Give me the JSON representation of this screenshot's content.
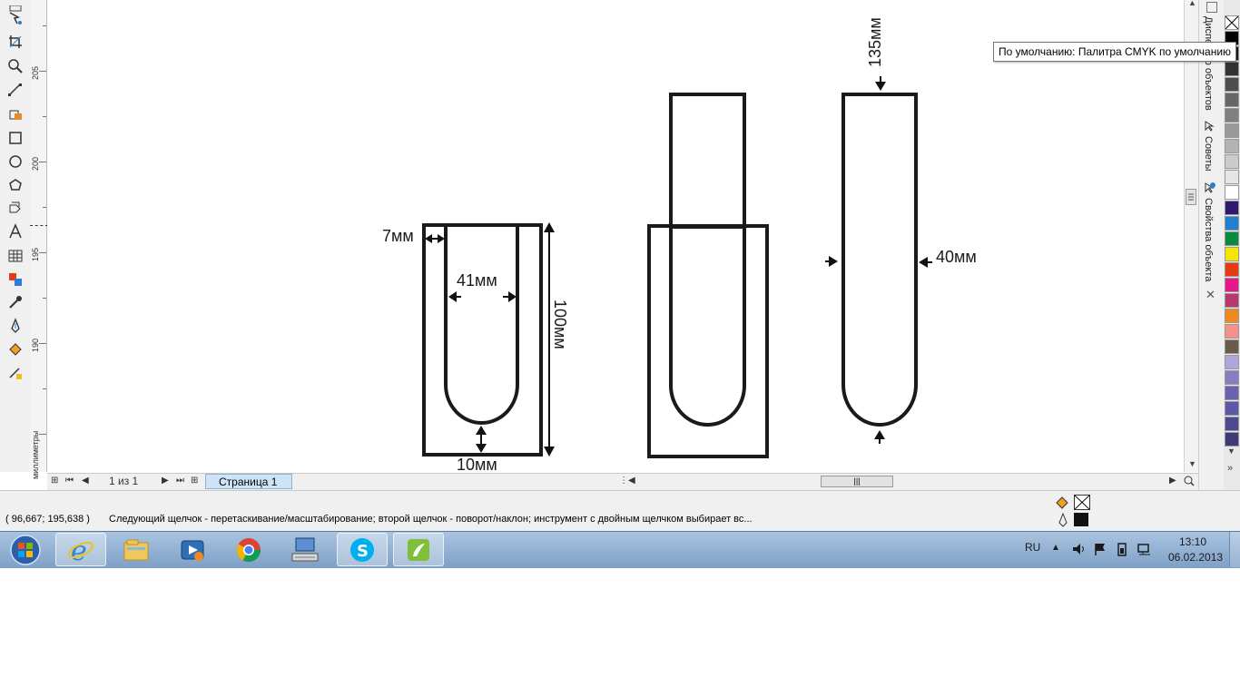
{
  "tooltip": "По умолчанию: Палитра CMYK по умолчанию",
  "ruler": {
    "unit": "миллиметры",
    "labels": [
      "205",
      "200",
      "195",
      "190"
    ]
  },
  "dockers": {
    "tab1": "Диспетчер объектов",
    "tab2": "Советы",
    "tab3": "Свойства объекта"
  },
  "drawing": {
    "dim_7": "7мм",
    "dim_41": "41мм",
    "dim_100": "100мм",
    "dim_10": "10мм",
    "dim_135": "135мм",
    "dim_40": "40мм"
  },
  "pagenav": {
    "counter": "1 из 1",
    "tab": "Страница 1"
  },
  "status": {
    "coords": "( 96,667; 195,638 )",
    "message": "Следующий щелчок - перетаскивание/масштабирование; второй щелчок - поворот/наклон; инструмент с двойным щелчком выбирает вс..."
  },
  "taskbar": {
    "lang": "RU",
    "time": "13:10",
    "date": "06.02.2013"
  },
  "palette_colors": [
    "#000000",
    "#1a1a1a",
    "#333333",
    "#4d4d4d",
    "#666666",
    "#808080",
    "#999999",
    "#b3b3b3",
    "#cccccc",
    "#e6e6e6",
    "#ffffff",
    "#2e1a6e",
    "#1f7fd0",
    "#0a8a3c",
    "#f5e600",
    "#e63a12",
    "#e8188a",
    "#b8386e",
    "#f08a1e",
    "#f2918a",
    "#6b5a4a",
    "#b0a6d8",
    "#8a7cc0",
    "#6a62b0",
    "#5c5aa8",
    "#4e4a90",
    "#3e3a78"
  ]
}
